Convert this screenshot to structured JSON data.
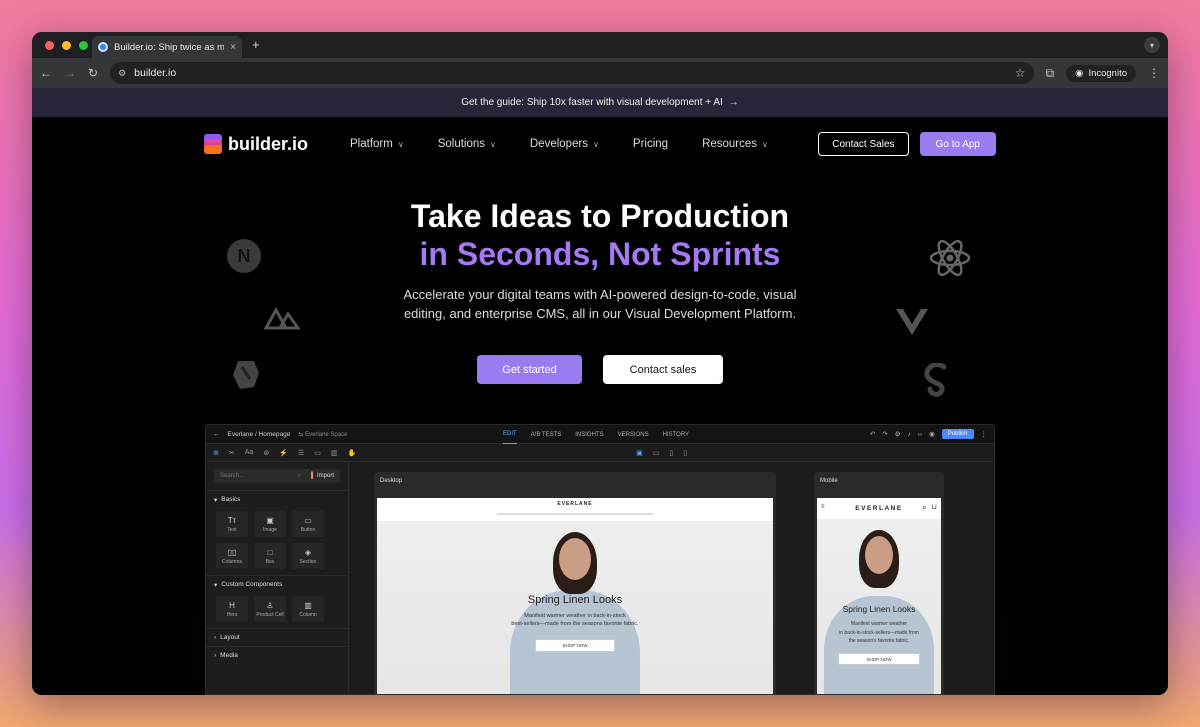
{
  "browser": {
    "tab_title": "Builder.io: Ship twice as much",
    "tab_close": "×",
    "new_tab": "+",
    "url": "builder.io",
    "incognito_label": "Incognito"
  },
  "banner": {
    "text": "Get the guide: Ship 10x faster with visual development + AI",
    "arrow": "→"
  },
  "nav": {
    "logo_text": "builder.io",
    "links": [
      "Platform",
      "Solutions",
      "Developers",
      "Pricing",
      "Resources"
    ],
    "contact_sales": "Contact Sales",
    "go_to_app": "Go to App"
  },
  "hero": {
    "title_line1": "Take Ideas to Production",
    "title_line2": "in Seconds, Not Sprints",
    "subtitle_line1": "Accelerate your digital teams with AI-powered design-to-code, visual",
    "subtitle_line2": "editing, and enterprise CMS, all in our Visual Development Platform.",
    "cta_primary": "Get started",
    "cta_secondary": "Contact sales"
  },
  "editor": {
    "breadcrumb": "Everlane / Homepage",
    "space": "Everlane Space",
    "tabs": [
      "EDIT",
      "A/B TESTS",
      "INSIGHTS",
      "VERSIONS",
      "HISTORY"
    ],
    "publish": "Publish",
    "search_placeholder": "Search...",
    "import": "Import",
    "basics": "Basics",
    "basic_items": [
      "Text",
      "Image",
      "Button",
      "Columns",
      "Box",
      "Section"
    ],
    "custom_components": "Custom Components",
    "custom_items": [
      "Hero",
      "Product Cell",
      "Column"
    ],
    "layout": "Layout",
    "media": "Media",
    "desktop_label": "Desktop",
    "mobile_label": "Mobile",
    "brand": "EVERLANE",
    "promo_title": "Spring Linen Looks",
    "promo_text_d1": "Manifest warmer weather in back-in-stock",
    "promo_text_d2": "best-sellers—made from the seasons favorite fabric.",
    "promo_text_m1": "Manifest warmer weather",
    "promo_text_m2": "in back-in-stock-sellers—made from",
    "promo_text_m3": "the season's favorite fabric.",
    "shop_now": "SHOP NOW"
  },
  "colors": {
    "accent_purple": "#9b7bf0",
    "headline_purple": "#a679f2",
    "publish_blue": "#4b88ff"
  }
}
